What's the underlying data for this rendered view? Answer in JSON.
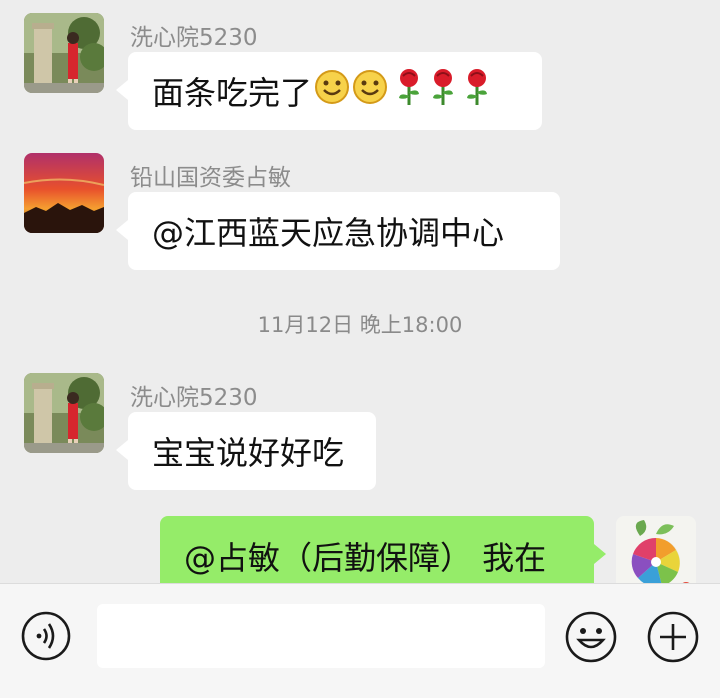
{
  "messages": [
    {
      "sender": "洗心院5230",
      "text": "面条吃完了"
    },
    {
      "sender": "铅山国资委占敏",
      "text": "@江西蓝天应急协调中心"
    },
    {
      "sender": "洗心院5230",
      "text": "宝宝说好好吃"
    },
    {
      "sender": "",
      "text": "@占敏（后勤保障） 我在"
    }
  ],
  "timestamp": "11月12日 晚上18:00",
  "message_1_emojis": [
    "smile-emoji",
    "smile-emoji",
    "rose-emoji",
    "rose-emoji",
    "rose-emoji"
  ],
  "colors": {
    "background": "#ededed",
    "bubble_incoming": "#ffffff",
    "bubble_outgoing": "#95ec69",
    "sender_text": "#8c8c8c"
  },
  "bottom_bar": {
    "left_icon": "voice-icon",
    "right_icons": [
      "emoji-icon",
      "plus-icon"
    ]
  }
}
